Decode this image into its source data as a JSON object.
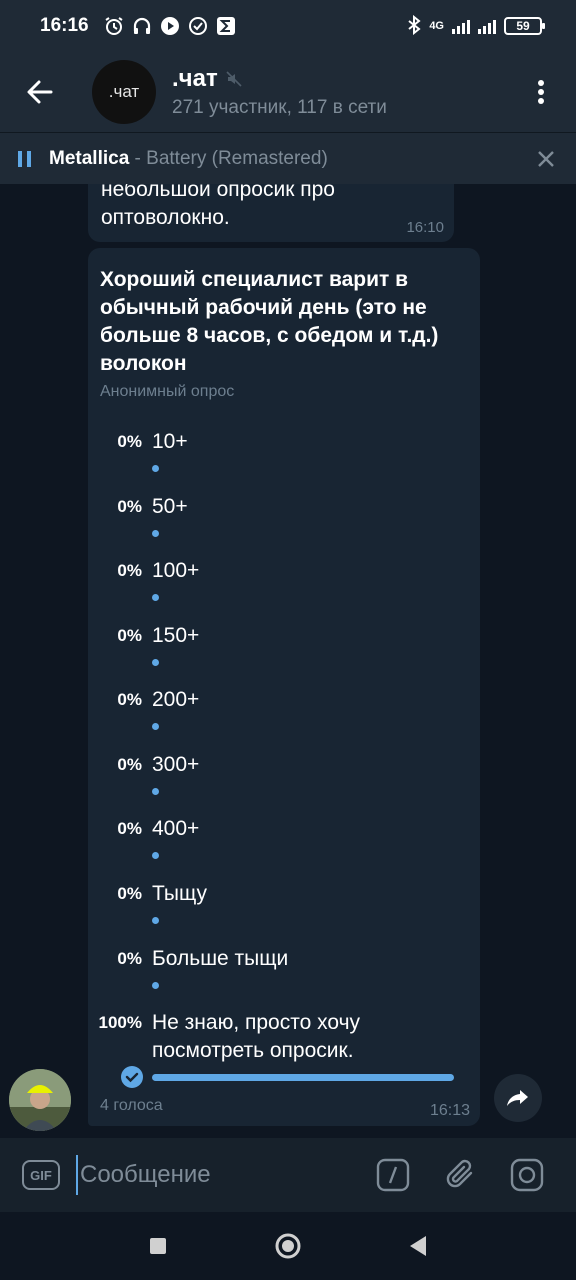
{
  "status_bar": {
    "time": "16:16",
    "network": "4G",
    "battery": "59"
  },
  "header": {
    "avatar_text": ".чат",
    "title": ".чат",
    "subtitle": "271 участник, 117 в сети"
  },
  "music": {
    "artist": "Metallica",
    "separator": " - ",
    "track": "Battery (Remastered)"
  },
  "previous_message": {
    "text": "небольшой опросик про оптоволокно.",
    "time": "16:10"
  },
  "poll": {
    "question": "Хороший специалист варит в обычный рабочий день (это не больше 8 часов, с обедом и т.д.) волокон",
    "type": "Анонимный опрос",
    "options": [
      {
        "percent": "0%",
        "text": "10+",
        "fraction": 0
      },
      {
        "percent": "0%",
        "text": "50+",
        "fraction": 0
      },
      {
        "percent": "0%",
        "text": "100+",
        "fraction": 0
      },
      {
        "percent": "0%",
        "text": "150+",
        "fraction": 0
      },
      {
        "percent": "0%",
        "text": "200+",
        "fraction": 0
      },
      {
        "percent": "0%",
        "text": "300+",
        "fraction": 0
      },
      {
        "percent": "0%",
        "text": "400+",
        "fraction": 0
      },
      {
        "percent": "0%",
        "text": "Тыщу",
        "fraction": 0
      },
      {
        "percent": "0%",
        "text": "Больше тыщи",
        "fraction": 0
      },
      {
        "percent": "100%",
        "text": "Не знаю, просто хочу посмотреть опросик.",
        "fraction": 1,
        "chosen": true
      }
    ],
    "votes": "4 голоса",
    "time": "16:13"
  },
  "input": {
    "gif_label": "GIF",
    "placeholder": "Сообщение",
    "value": ""
  },
  "icons": [
    "back-arrow-icon",
    "mute-icon",
    "more-vertical-icon",
    "pause-icon",
    "close-icon",
    "check-icon",
    "share-icon",
    "command-icon",
    "paperclip-icon",
    "camera-icon",
    "square-nav-icon",
    "circle-nav-icon",
    "triangle-nav-icon"
  ],
  "colors": {
    "accent": "#5fa8e6",
    "background": "#0e1621",
    "bubble": "#182533",
    "header": "#1f2a36",
    "muted": "#7f8c98"
  }
}
